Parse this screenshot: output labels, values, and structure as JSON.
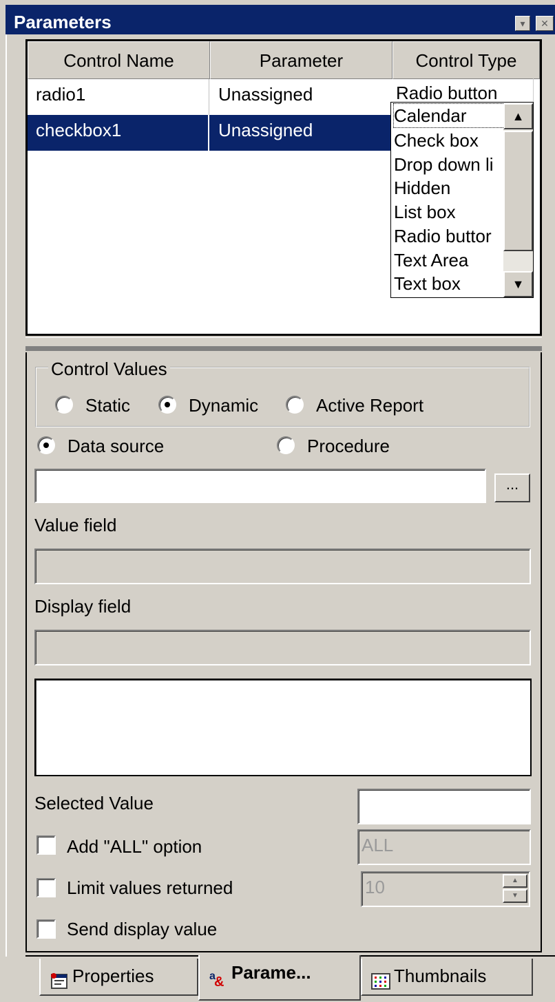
{
  "window": {
    "title": "Parameters",
    "close_glyph": "✕"
  },
  "grid": {
    "columns": [
      "Control Name",
      "Parameter",
      "Control Type"
    ],
    "rows": [
      {
        "control_name": "radio1",
        "parameter": "Unassigned",
        "control_type": "Radio button"
      },
      {
        "control_name": "checkbox1",
        "parameter": "Unassigned",
        "control_type": ""
      }
    ],
    "dropdown_options": [
      "Calendar",
      "Check box",
      "Drop down li",
      "Hidden",
      "List box",
      "Radio buttor",
      "Text Area",
      "Text box"
    ],
    "dropdown_focused": "Calendar"
  },
  "control_values": {
    "legend": "Control Values",
    "options": [
      "Static",
      "Dynamic",
      "Active Report"
    ],
    "selected": "Dynamic"
  },
  "source": {
    "options": [
      "Data source",
      "Procedure"
    ],
    "selected": "Data source",
    "path_value": "",
    "browse_label": "..."
  },
  "fields": {
    "value_field_label": "Value field",
    "value_field_value": "",
    "display_field_label": "Display field",
    "display_field_value": ""
  },
  "options": {
    "selected_value_label": "Selected Value",
    "selected_value": "",
    "add_all_label": "Add \"ALL\" option",
    "add_all_checked": false,
    "add_all_value": "ALL",
    "limit_label": "Limit values returned",
    "limit_checked": false,
    "limit_value": "10",
    "send_display_label": "Send display value",
    "send_display_checked": false
  },
  "tabs": [
    {
      "label": "Properties",
      "icon": "properties-icon",
      "active": false
    },
    {
      "label": "Parame...",
      "icon": "parameters-icon",
      "active": true
    },
    {
      "label": "Thumbnails",
      "icon": "thumbnails-icon",
      "active": false
    }
  ],
  "colors": {
    "titlebar": "#0a246a",
    "selection": "#0a246a",
    "face": "#d4d0c8"
  }
}
